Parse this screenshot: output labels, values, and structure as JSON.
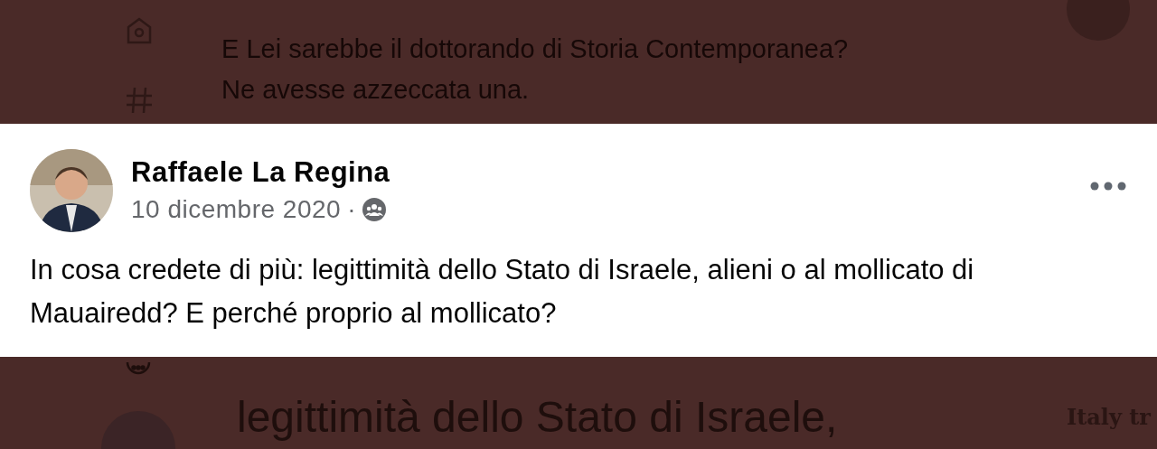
{
  "background_feed": {
    "lines": [
      "E Lei sarebbe il dottorando di Storia Contemporanea?",
      "Ne avesse azzeccata una."
    ],
    "lower_text": "legittimità dello Stato di Israele,",
    "side_text": "Italy tr"
  },
  "post": {
    "author": "Raffaele La Regina",
    "date": "10 dicembre 2020",
    "separator": "·",
    "text": "In cosa credete di più: legittimità dello Stato di Israele, alieni o al mollicato di Mauairedd? E perché proprio al mollicato?"
  }
}
